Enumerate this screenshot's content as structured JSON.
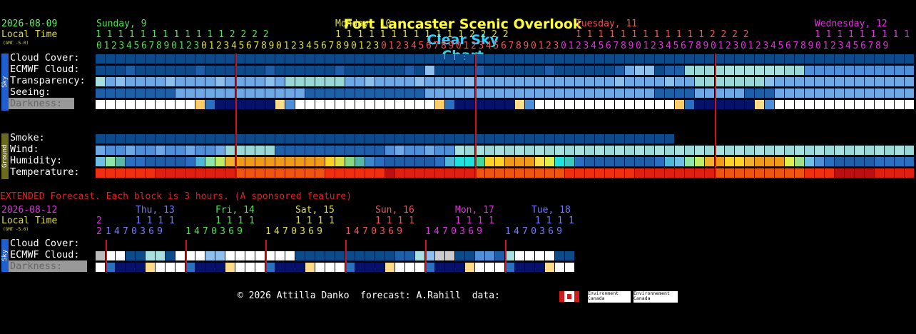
{
  "title": {
    "location": "Fort Lancaster Scenic Overlook",
    "clear_sky": "Clear Sky",
    "chart": "Chart",
    "colors": {
      "location": "#ffff33",
      "clear_sky": "#33ccff",
      "chart": "#33ccdd"
    }
  },
  "header": {
    "date": "2026-08-09",
    "local_time": "Local Time",
    "gmt": "(GMT -5.0)",
    "days": [
      {
        "label": "Sunday, 9",
        "color": "#55dd55"
      },
      {
        "label": "Monday, 10",
        "color": "#dddd44"
      },
      {
        "label": "Tuesday, 11",
        "color": "#ee5555"
      },
      {
        "label": "Wednesday, 12",
        "color": "#dd33dd"
      }
    ],
    "hours_tens": [
      "      1 1 1 1 1 1 1 1 1 1 1 1 2 2 2 2",
      "1 1 1 1 1 1 1 1 1 1 1 1 2 2 2 2",
      "1 1 1 1 1 1 1 1 1 1 1 1 2 2 2 2",
      "1 1 1 1 1 1 1 1 1 1"
    ],
    "hours_ones": "0 1 2 3 4 5 6 7 8 9 0 1 2 3 0 1 2 3 4 5 6 7 8 9 0 1 2 3 4 5 6 7 8 9 0 1 2 3 0 1 2 3 4 5 6 7 8 9 0 1 2 3 4 5 6 7 8 9 0 1 2 3 0 1 2 3 4 5 6 7 8 9 0 1 2 3 4 5 6 7 8 9 0 1 2 3 0 1 2 3 4 5 6 7 8 9 0 1 2 3 4 5 6 7 8 9"
  },
  "sky_rows": [
    "Cloud Cover:",
    "ECMWF Cloud:",
    "Transparency:",
    "Seeing:",
    "Darkness:"
  ],
  "ground_rows": [
    "Smoke:",
    "Wind:",
    "Humidity:",
    "Temperature:"
  ],
  "sidebars": {
    "sky": "Sky",
    "ground": "Ground",
    "sky_color": "#1f5fcf",
    "ground_color": "#6b6b1f"
  },
  "extended": {
    "note": "EXTENDED Forecast. Each block is 3 hours. (A sponsored feature)",
    "date": "2026-08-12",
    "local_time": "Local Time",
    "gmt": "(GMT -5.0)",
    "days": [
      {
        "label": "Thu, 13",
        "color": "#7777ff"
      },
      {
        "label": "Fri, 14",
        "color": "#55dd55"
      },
      {
        "label": "Sat, 15",
        "color": "#dddd44"
      },
      {
        "label": "Sun, 16",
        "color": "#ee5555"
      },
      {
        "label": "Mon, 17",
        "color": "#dd33dd"
      },
      {
        "label": "Tue, 18",
        "color": "#7777ff"
      }
    ],
    "first_tens": "2",
    "hour_tens": "1 1 1 1",
    "first_hour": "2",
    "hour_ones": "1 4 7 0 3 6 9",
    "rows": [
      "Cloud Cover:",
      "ECMWF Cloud:",
      "Darkness:"
    ]
  },
  "footer": {
    "copyright": "© 2026 Attilla Danko  forecast: A.Rahill  data:",
    "env_en": "Environment Canada",
    "env_fr": "Environnement Canada"
  }
}
